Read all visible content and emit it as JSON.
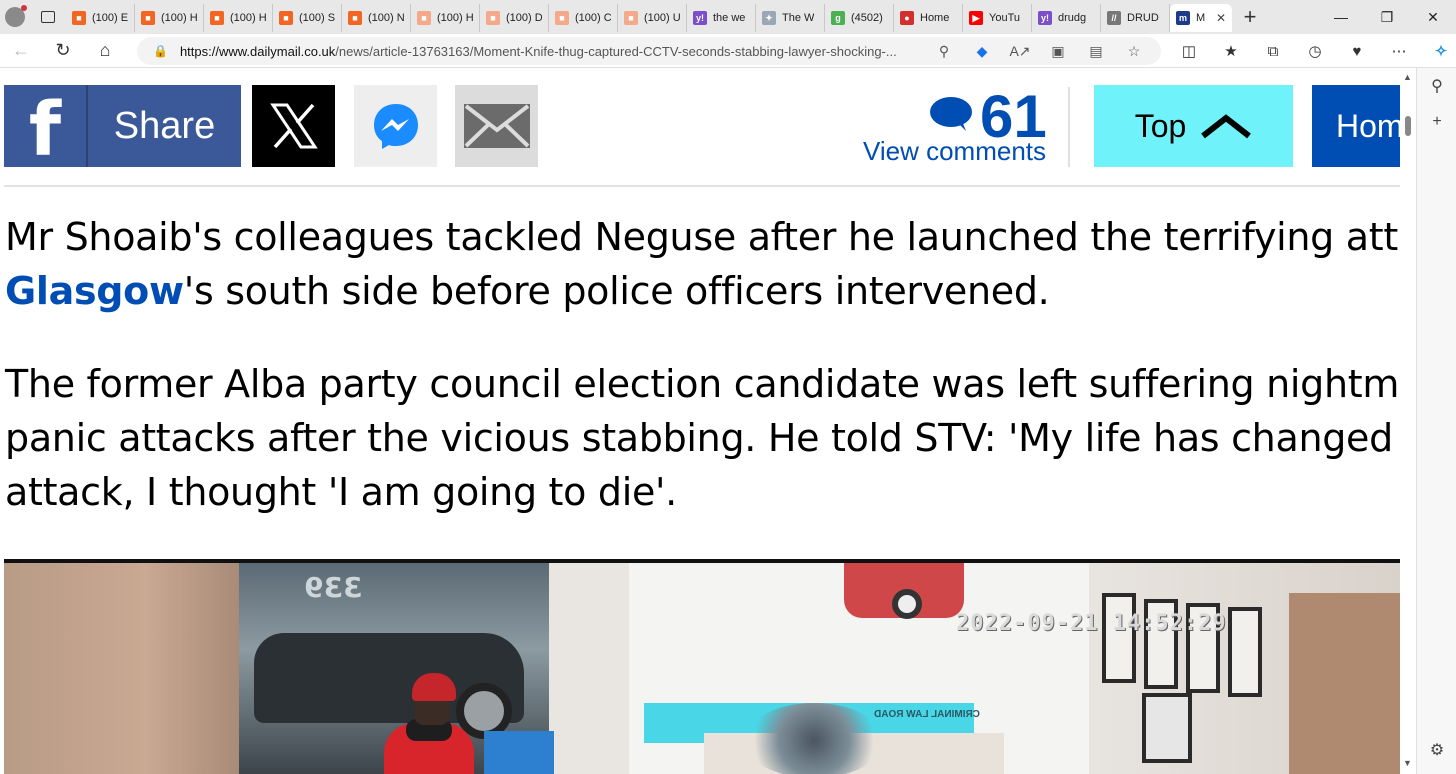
{
  "browser": {
    "tabs": [
      {
        "label": "(100) E",
        "fav_color": "#f26522",
        "glyph": "■"
      },
      {
        "label": "(100) H",
        "fav_color": "#f26522",
        "glyph": "■"
      },
      {
        "label": "(100) H",
        "fav_color": "#f26522",
        "glyph": "■"
      },
      {
        "label": "(100) S",
        "fav_color": "#f26522",
        "glyph": "■"
      },
      {
        "label": "(100) N",
        "fav_color": "#f26522",
        "glyph": "■"
      },
      {
        "label": "(100) H",
        "fav_color": "#f4a98a",
        "glyph": "■"
      },
      {
        "label": "(100) D",
        "fav_color": "#f4a98a",
        "glyph": "■"
      },
      {
        "label": "(100) C",
        "fav_color": "#f4a98a",
        "glyph": "■"
      },
      {
        "label": "(100) U",
        "fav_color": "#f4a98a",
        "glyph": "■"
      },
      {
        "label": "the we",
        "fav_color": "#7b4fc9",
        "glyph": "y!"
      },
      {
        "label": "The W",
        "fav_color": "#9aa7b4",
        "glyph": "✦"
      },
      {
        "label": "(4502)",
        "fav_color": "#4caf50",
        "glyph": "g"
      },
      {
        "label": "Home",
        "fav_color": "#d32f2f",
        "glyph": "●"
      },
      {
        "label": "YouTu",
        "fav_color": "#ff0000",
        "glyph": "▶"
      },
      {
        "label": "drudg",
        "fav_color": "#7b4fc9",
        "glyph": "y!"
      },
      {
        "label": "DRUD",
        "fav_color": "#777777",
        "glyph": "//"
      }
    ],
    "active_tab": {
      "label": "M",
      "fav_color": "#1e3a8a",
      "glyph": "m",
      "close": "✕"
    },
    "new_tab": "+",
    "window_controls": {
      "minimize": "—",
      "maximize": "❐",
      "close": "✕"
    },
    "url_host": "https://www.dailymail.co.uk",
    "url_path": "/news/article-13763163/Moment-Knife-thug-captured-CCTV-seconds-stabbing-lawyer-shocking-..."
  },
  "sharebar": {
    "facebook_glyph": "f",
    "facebook_label": "Share",
    "comment_count": "61",
    "view_comments": "View comments",
    "top_label": "Top",
    "home_label": "Home"
  },
  "article": {
    "p1_line1": "Mr Shoaib's colleagues tackled Neguse after he launched the terrifying attack in",
    "p1_link": "Glasgow",
    "p1_line2_rest": "'s south side before police officers intervened.",
    "p2_line1": "The former Alba party council election candidate was left suffering nightmares and",
    "p2_line2": "panic attacks after the vicious stabbing. He told STV: 'My life has changed since the",
    "p2_line3": "attack, I thought 'I am going to die'."
  },
  "video": {
    "timestamp": "2022-09-21 14:52:29",
    "window_sign": "339",
    "counter_sign": "CRIMINAL LAW ROAD"
  },
  "colors": {
    "facebook": "#3b5998",
    "dailymail_blue": "#004db3",
    "top_button": "#6ff2fa"
  }
}
